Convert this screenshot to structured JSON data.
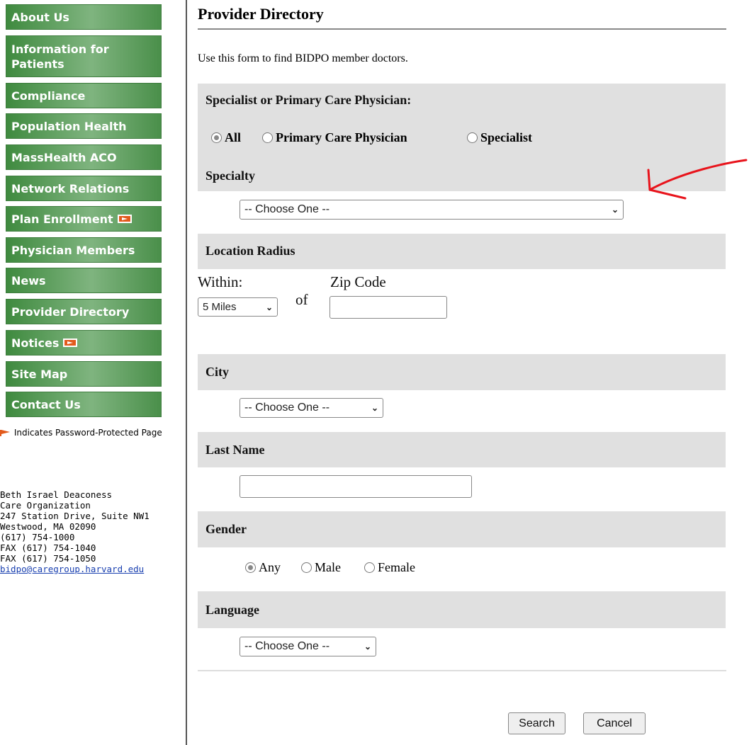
{
  "sidebar": {
    "items": [
      {
        "label": "About Us"
      },
      {
        "label": "Information for Patients"
      },
      {
        "label": "Compliance"
      },
      {
        "label": "Population Health"
      },
      {
        "label": "MassHealth ACO"
      },
      {
        "label": "Network Relations"
      },
      {
        "label": "Plan Enrollment"
      },
      {
        "label": "Physician Members"
      },
      {
        "label": "News"
      },
      {
        "label": "Provider Directory"
      },
      {
        "label": "Notices"
      },
      {
        "label": "Site Map"
      },
      {
        "label": "Contact Us"
      }
    ],
    "legend": "Indicates Password-Protected Page",
    "address": {
      "line1": "Beth Israel Deaconess",
      "line2": "Care Organization",
      "line3": "247 Station Drive, Suite NW1",
      "line4": "Westwood, MA 02090",
      "line5": "(617) 754-1000",
      "line6": "FAX (617) 754-1040",
      "line7": "FAX (617) 754-1050",
      "email": "bidpo@caregroup.harvard.edu"
    }
  },
  "main": {
    "title": "Provider Directory",
    "intro": "Use this form to find BIDPO member doctors.",
    "physician_type": {
      "heading": "Specialist or Primary Care Physician:",
      "options": [
        "All",
        "Primary Care Physician",
        "Specialist"
      ],
      "selected": "All"
    },
    "specialty": {
      "heading": "Specialty",
      "value": "-- Choose One --"
    },
    "location": {
      "heading": "Location Radius",
      "within_label": "Within:",
      "within_value": "5 Miles",
      "of_label": "of",
      "zip_label": "Zip Code",
      "zip_value": ""
    },
    "city": {
      "heading": "City",
      "value": "-- Choose One --"
    },
    "last_name": {
      "heading": "Last Name",
      "value": ""
    },
    "gender": {
      "heading": "Gender",
      "options": [
        "Any",
        "Male",
        "Female"
      ],
      "selected": "Any"
    },
    "language": {
      "heading": "Language",
      "value": "-- Choose One --"
    },
    "buttons": {
      "search": "Search",
      "cancel": "Cancel"
    }
  },
  "colors": {
    "nav_green": "#3f8a3f",
    "band_gray": "#e0e0e0",
    "annotation_red": "#e8141c",
    "link_blue": "#1a40b0"
  }
}
